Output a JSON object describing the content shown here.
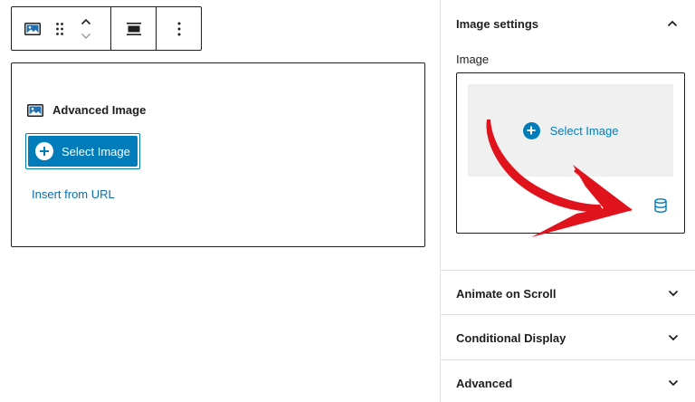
{
  "toolbar": {
    "icons": [
      "image-icon",
      "drag-handle-icon",
      "chevron-up-icon",
      "chevron-down-icon",
      "align-icon",
      "more-options-icon"
    ]
  },
  "block": {
    "title": "Advanced Image",
    "select_label": "Select Image",
    "insert_url_label": "Insert from URL"
  },
  "sidebar": {
    "image_settings": {
      "title": "Image settings",
      "image_label": "Image",
      "select_label": "Select Image"
    },
    "panels": [
      {
        "title": "Animate on Scroll"
      },
      {
        "title": "Conditional Display"
      },
      {
        "title": "Advanced"
      }
    ]
  },
  "colors": {
    "accent": "#007cba",
    "link": "#0a6ead",
    "arrow": "#e0121b",
    "border": "#1e1e1e",
    "divider": "#e0e0e0",
    "placeholder_bg": "#f0f0f0"
  }
}
